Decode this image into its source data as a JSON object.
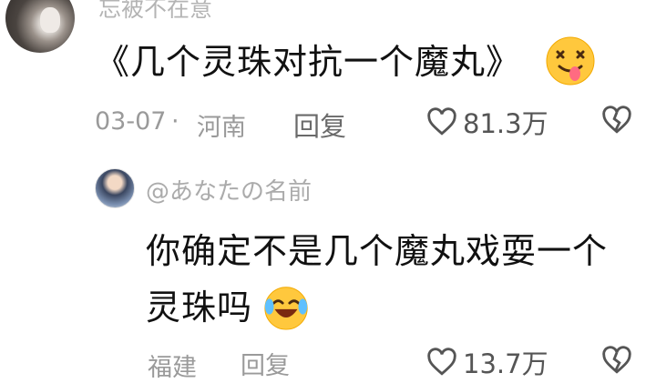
{
  "comment": {
    "username": "忘被不在意",
    "text": "《几个灵珠对抗一个魔丸》",
    "emoji": "face-with-tongue-emoji",
    "date": "03-07",
    "separator": "·",
    "location": "河南",
    "reply_label": "回复",
    "like_count": "81.3万"
  },
  "reply": {
    "username": "@あなたの名前",
    "text_line1": "你确定不是几个魔丸戏耍一个",
    "text_line2": "灵珠吗",
    "emoji": "laughing-emoji",
    "location": "福建",
    "reply_label": "回复",
    "like_count": "13.7万"
  }
}
